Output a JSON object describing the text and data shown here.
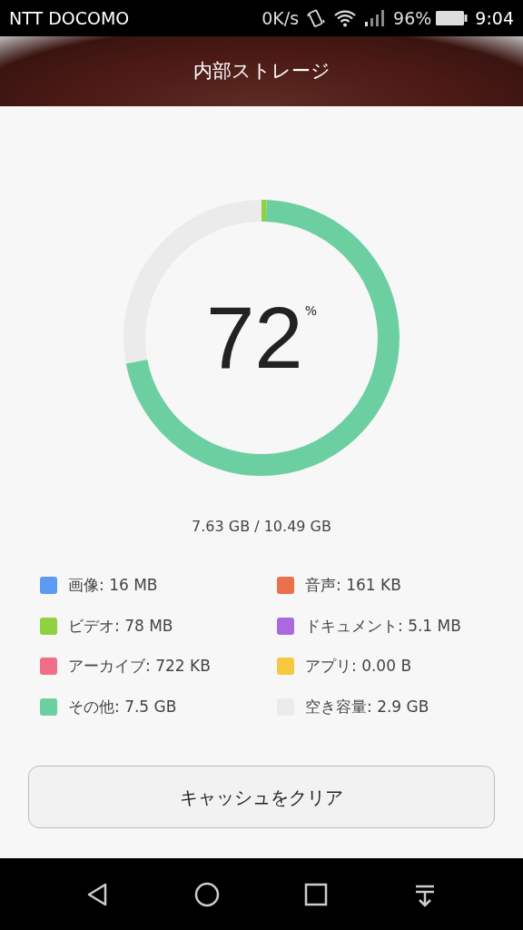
{
  "status_bar": {
    "carrier": "NTT DOCOMO",
    "speed": "0K/s",
    "battery": "96%",
    "time": "9:04"
  },
  "header": {
    "title": "内部ストレージ"
  },
  "gauge": {
    "value": "72",
    "unit": "%"
  },
  "usage": "7.63 GB / 10.49 GB",
  "legend": [
    {
      "label": "画像: 16 MB",
      "color": "#5b9cf2"
    },
    {
      "label": "音声: 161 KB",
      "color": "#e8704a"
    },
    {
      "label": "ビデオ: 78 MB",
      "color": "#8fd13f"
    },
    {
      "label": "ドキュメント: 5.1 MB",
      "color": "#a96ae0"
    },
    {
      "label": "アーカイブ: 722 KB",
      "color": "#f06e86"
    },
    {
      "label": "アプリ: 0.00 B",
      "color": "#f8c740"
    },
    {
      "label": "その他: 7.5 GB",
      "color": "#6ccfa2"
    },
    {
      "label": "空き容量: 2.9 GB",
      "color": "#ebebeb"
    }
  ],
  "button": {
    "label": "キャッシュをクリア"
  }
}
